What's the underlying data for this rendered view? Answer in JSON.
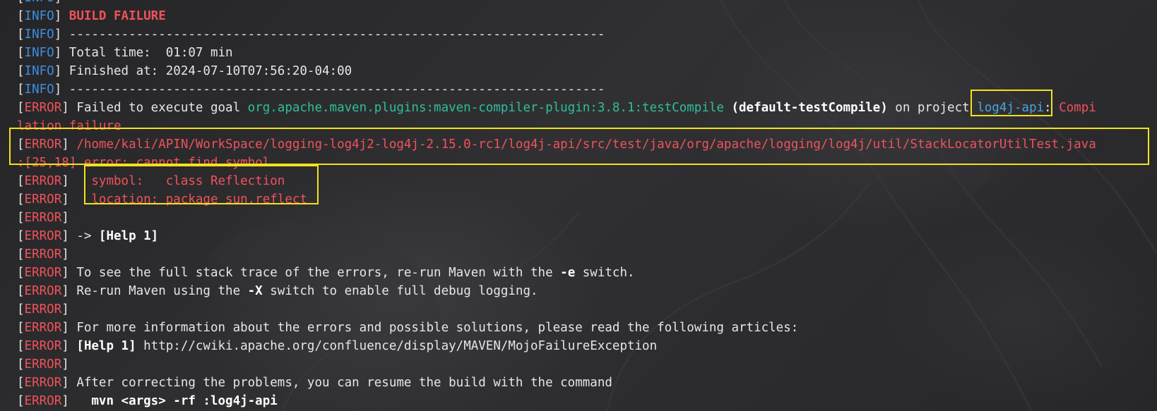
{
  "levels": {
    "info": "INFO",
    "error": "ERROR"
  },
  "lines": {
    "l0": {
      "text": ""
    },
    "l1": {
      "text": "BUILD FAILURE"
    },
    "l2": {
      "text": "------------------------------------------------------------------------"
    },
    "l3": {
      "text": "Total time:  01:07 min"
    },
    "l4": {
      "text": "Finished at: 2024-07-10T07:56:20-04:00"
    },
    "l5": {
      "text": "------------------------------------------------------------------------"
    },
    "l6": {
      "p1": "Failed to execute goal ",
      "goal": "org.apache.maven.plugins:maven-compiler-plugin:3.8.1:testCompile",
      "p2": " ",
      "execution": "(default-testCompile)",
      "p3": " on project ",
      "project": "log4j-api",
      "p4": ": ",
      "p5": "Compi"
    },
    "l7": {
      "text": "lation failure"
    },
    "l8": {
      "text": "/home/kali/APIN/WorkSpace/logging-log4j2-log4j-2.15.0-rc1/log4j-api/src/test/java/org/apache/logging/log4j/util/StackLocatorUtilTest.java"
    },
    "l9": {
      "text": ":[25,18] error: cannot find symbol"
    },
    "l10": {
      "text": "  symbol:   class Reflection"
    },
    "l11": {
      "text": "  location: package sun.reflect"
    },
    "l12": {
      "text": ""
    },
    "l13": {
      "p1": "-> ",
      "help": "[Help 1]"
    },
    "l14": {
      "text": ""
    },
    "l15": {
      "p1": "To see the full stack trace of the errors, re-run Maven with the ",
      "flag": "-e",
      "p2": " switch."
    },
    "l16": {
      "p1": "Re-run Maven using the ",
      "flag": "-X",
      "p2": " switch to enable full debug logging."
    },
    "l17": {
      "text": ""
    },
    "l18": {
      "text": "For more information about the errors and possible solutions, please read the following articles:"
    },
    "l19": {
      "help": "[Help 1]",
      "url": " http://cwiki.apache.org/confluence/display/MAVEN/MojoFailureException"
    },
    "l20": {
      "text": ""
    },
    "l21": {
      "text": "After correcting the problems, you can resume the build with the command"
    },
    "l22": {
      "text": "  mvn <args> -rf :log4j-api"
    }
  },
  "colors": {
    "info": "#3d8ee0",
    "error": "#f0525a",
    "goal": "#2fbf9a",
    "project": "#4aa3e0",
    "highlight": "#f2e21a"
  }
}
